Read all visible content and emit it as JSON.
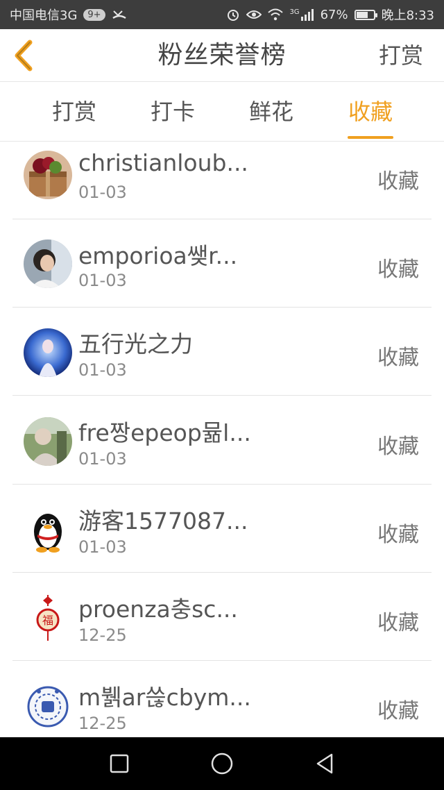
{
  "status_bar": {
    "carrier": "中国电信3G",
    "badge": "9+",
    "network": "3G",
    "battery": "67%",
    "battery_level": 0.67,
    "time": "晚上8:33"
  },
  "header": {
    "title": "粉丝荣誉榜",
    "action": "打赏"
  },
  "tabs": [
    {
      "label": "打赏",
      "active": false
    },
    {
      "label": "打卡",
      "active": false
    },
    {
      "label": "鲜花",
      "active": false
    },
    {
      "label": "收藏",
      "active": true
    }
  ],
  "list": {
    "items": [
      {
        "name": "christianloub...",
        "date": "01-03",
        "action": "收藏",
        "avatar": "gift-box-avatar"
      },
      {
        "name": "emporioa쌪r...",
        "date": "01-03",
        "action": "收藏",
        "avatar": "girl-photo-avatar"
      },
      {
        "name": "五行光之力",
        "date": "01-03",
        "action": "收藏",
        "avatar": "fantasy-character-avatar"
      },
      {
        "name": "fre짱epeop뮮l...",
        "date": "01-03",
        "action": "收藏",
        "avatar": "outdoor-photo-avatar"
      },
      {
        "name": "游客1577087...",
        "date": "01-03",
        "action": "收藏",
        "avatar": "qq-penguin-avatar"
      },
      {
        "name": "proenza충sc...",
        "date": "12-25",
        "action": "收藏",
        "avatar": "fu-knot-avatar"
      },
      {
        "name": "m뷁ar쓶cbym...",
        "date": "12-25",
        "action": "收藏",
        "avatar": "porcelain-avatar"
      }
    ]
  },
  "colors": {
    "accent": "#f0a020",
    "status_bar": "#3d3d3d",
    "nav_bar": "#000000"
  }
}
